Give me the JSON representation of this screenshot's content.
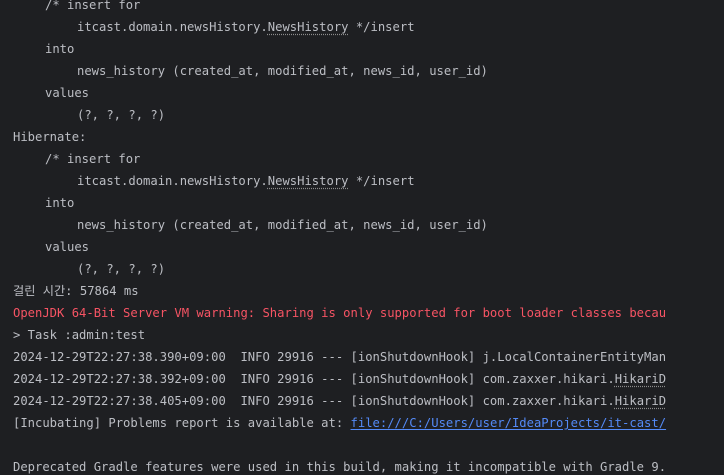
{
  "sql_block_1": {
    "comment_prefix": "/* insert for",
    "entity_package": "itcast.domain.newsHistory.",
    "entity_class": "NewsHistory",
    "comment_suffix": " */insert",
    "into": "into",
    "table": "news_history (created_at, modified_at, news_id, user_id)",
    "values": "values",
    "params": "(?, ?, ?, ?)"
  },
  "hibernate_label": "Hibernate:",
  "sql_block_2": {
    "comment_prefix": "/* insert for",
    "entity_package": "itcast.domain.newsHistory.",
    "entity_class": "NewsHistory",
    "comment_suffix": " */insert",
    "into": "into",
    "table": "news_history (created_at, modified_at, news_id, user_id)",
    "values": "values",
    "params": "(?, ?, ?, ?)"
  },
  "elapsed": "걸린 시간: 57864 ms",
  "jvm_warning": "OpenJDK 64-Bit Server VM warning: Sharing is only supported for boot loader classes becau",
  "task": "> Task :admin:test",
  "logs": [
    {
      "prefix": "2024-12-29T22:27:38.390+09:00  INFO 29916 --- [ionShutdownHook] j.LocalContainerEntityMan",
      "dotted": ""
    },
    {
      "prefix": "2024-12-29T22:27:38.392+09:00  INFO 29916 --- [ionShutdownHook] com.zaxxer.hikari.",
      "dotted": "HikariD"
    },
    {
      "prefix": "2024-12-29T22:27:38.405+09:00  INFO 29916 --- [ionShutdownHook] com.zaxxer.hikari.",
      "dotted": "HikariD"
    }
  ],
  "problems_report": {
    "text": "[Incubating] Problems report is available at: ",
    "link": "file:///C:/Users/user/IdeaProjects/it-cast/"
  },
  "gradle_deprecation": "Deprecated Gradle features were used in this build, making it incompatible with Gradle 9.",
  "colors": {
    "background": "#1e1f22",
    "text": "#bcbec4",
    "error": "#f75464",
    "link": "#548af7"
  }
}
